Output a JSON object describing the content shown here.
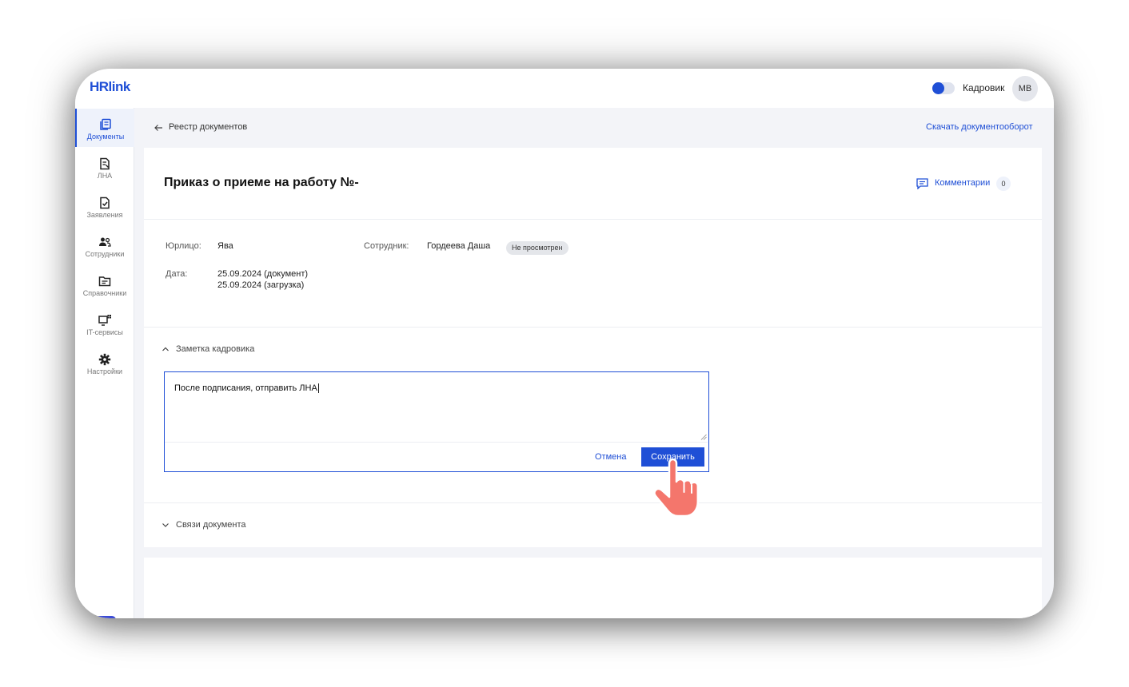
{
  "topbar": {
    "logo": "HRlink",
    "role_label": "Кадровик",
    "avatar_initials": "МВ"
  },
  "sidebar": {
    "items": [
      {
        "label": "Документы",
        "icon": "documents-icon",
        "active": true
      },
      {
        "label": "ЛНА",
        "icon": "lna-icon",
        "active": false
      },
      {
        "label": "Заявления",
        "icon": "applications-icon",
        "active": false
      },
      {
        "label": "Сотрудники",
        "icon": "employees-icon",
        "active": false
      },
      {
        "label": "Справочники",
        "icon": "folder-icon",
        "active": false
      },
      {
        "label": "IT-сервисы",
        "icon": "it-services-icon",
        "active": false
      },
      {
        "label": "Настройки",
        "icon": "gear-icon",
        "active": false
      }
    ],
    "help_label": "?"
  },
  "breadcrumb": {
    "back_label": "Реестр документов",
    "download_label": "Скачать документооборот"
  },
  "document": {
    "title": "Приказ о приеме на работу №-",
    "comments_label": "Комментарии",
    "comments_count": "0",
    "legal_entity_label": "Юрлицо:",
    "legal_entity_value": "Ява",
    "employee_label": "Сотрудник:",
    "employee_value": "Гордеева Даша",
    "status": "Не просмотрен",
    "date_label": "Дата:",
    "date_document": "25.09.2024 (документ)",
    "date_upload": "25.09.2024 (загрузка)"
  },
  "note_section": {
    "title": "Заметка кадровика",
    "text": "После подписания, отправить ЛНА",
    "cancel_label": "Отмена",
    "save_label": "Сохранить"
  },
  "links_section": {
    "title": "Связи документа"
  },
  "colors": {
    "accent": "#1f4fd6",
    "help_button": "#3c4bd6",
    "pointer_hand": "#f4766c"
  }
}
